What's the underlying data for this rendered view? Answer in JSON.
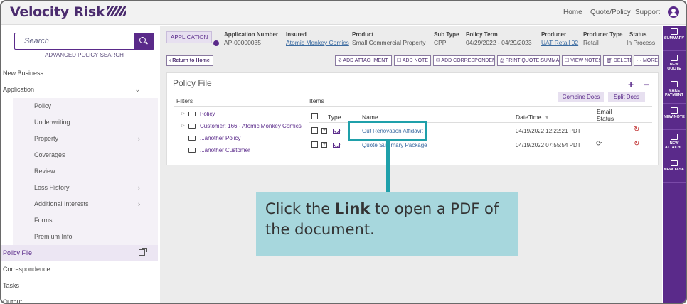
{
  "app": {
    "logo": "Velocity Risk"
  },
  "topnav": {
    "home": "Home",
    "quote_policy": "Quote/Policy",
    "support": "Support"
  },
  "search": {
    "placeholder": "Search"
  },
  "sidebar": {
    "advanced_search": "ADVANCED POLICY SEARCH",
    "items": [
      {
        "label": "New Business"
      },
      {
        "label": "Application",
        "chev": "⌄"
      },
      {
        "label": "Policy"
      },
      {
        "label": "Underwriting"
      },
      {
        "label": "Property",
        "chev": "›"
      },
      {
        "label": "Coverages"
      },
      {
        "label": "Review"
      },
      {
        "label": "Loss History",
        "chev": "›"
      },
      {
        "label": "Additional Interests",
        "chev": "›"
      },
      {
        "label": "Forms"
      },
      {
        "label": "Premium Info"
      },
      {
        "label": "Policy File"
      },
      {
        "label": "Correspondence"
      },
      {
        "label": "Tasks"
      },
      {
        "label": "Output"
      }
    ]
  },
  "header": {
    "tag": "APPLICATION",
    "app_number_label": "Application Number",
    "app_number": "AP-00000035",
    "insured_label": "Insured",
    "insured": "Atomic Monkey Comics",
    "product_label": "Product",
    "product": "Small Commercial Property",
    "subtype_label": "Sub Type",
    "subtype": "CPP",
    "term_label": "Policy Term",
    "term": "04/29/2022 - 04/29/2023",
    "producer_label": "Producer",
    "producer": "UAT Retail 02",
    "producer_type_label": "Producer Type",
    "producer_type": "Retail",
    "status_label": "Status",
    "status": "In Process"
  },
  "actions": {
    "return": "‹ Return to Home",
    "add_attachment": "⊘ ADD ATTACHMENT",
    "add_note": "☐ ADD NOTE",
    "add_correspondence": "✉ ADD CORRESPONDENCE",
    "print_quote": "⎙ PRINT QUOTE SUMMA...",
    "view_notes": "☐ VIEW NOTES",
    "delete": "🗑 DELETE",
    "more": "··· MORE"
  },
  "policy_file": {
    "title": "Policy File",
    "plus": "+",
    "minus": "−",
    "combine": "Combine Docs",
    "split": "Split Docs",
    "filters_label": "Filters",
    "items_label": "Items",
    "tree": [
      "Policy",
      "Customer: 166 - Atomic Monkey Comics",
      "...another Policy",
      "...another Customer"
    ],
    "columns": {
      "type": "Type",
      "name": "Name",
      "datetime": "DateTime",
      "email_status": "Email Status"
    },
    "rows": [
      {
        "name": "Gut Renovation Affidavit",
        "datetime": "04/19/2022 12:22:21 PDT"
      },
      {
        "name": "Quote Summary Package",
        "datetime": "04/19/2022 07:55:54 PDT"
      }
    ]
  },
  "callout": {
    "pre": "Click the ",
    "bold": "Link",
    "post": " to open a PDF of the document."
  },
  "rightbar": [
    "SUMMARY",
    "NEW QUOTE",
    "MAKE PAYMENT",
    "NEW NOTE",
    "NEW ATTACH...",
    "NEW TASK"
  ]
}
